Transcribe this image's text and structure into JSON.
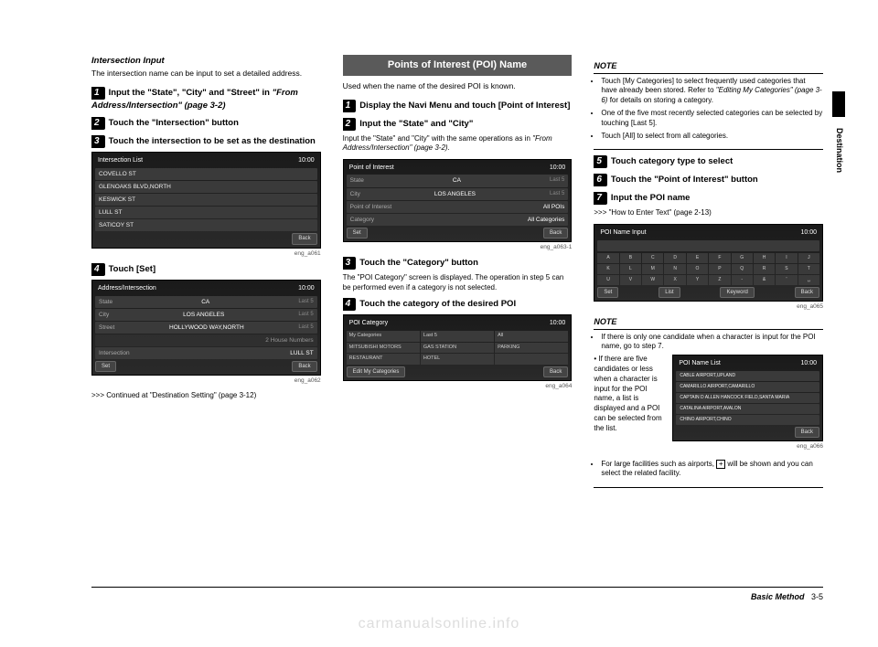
{
  "side_tab": "Destination",
  "footer": {
    "label": "Basic Method",
    "page": "3-5"
  },
  "watermark": "carmanualsonline.info",
  "col1": {
    "h1": "Intersection Input",
    "p1": "The intersection name can be input to set a detailed address.",
    "s1": "Input the \"State\", \"City\" and \"Street\" in ",
    "s1_i": "\"From Address/Intersection\" (page 3-2)",
    "s2": "Touch the \"Intersection\" button",
    "s3": "Touch the intersection to be set as the destination",
    "shot1": {
      "title": "Intersection List",
      "time": "10:00",
      "rows": [
        "COVELLO ST",
        "GLENOAKS BLVD,NORTH",
        "KESWICK ST",
        "LULL ST",
        "SATICOY ST"
      ],
      "back": "Back",
      "cap": "eng_a061"
    },
    "s4": "Touch [Set]",
    "shot2": {
      "title": "Address/Intersection",
      "time": "10:00",
      "rows": [
        {
          "label": "State",
          "val": "CA",
          "r": "Last 5"
        },
        {
          "label": "City",
          "val": "LOS ANGELES",
          "r": "Last 5"
        },
        {
          "label": "Street",
          "val": "HOLLYWOOD WAY,NORTH",
          "r": "Last 5"
        },
        {
          "label": "",
          "val": "2 House Numbers",
          "r": ""
        },
        {
          "label": "Intersection",
          "val": "LULL ST",
          "r": ""
        }
      ],
      "set": "Set",
      "back": "Back",
      "cap": "eng_a062"
    },
    "cont": ">>> Continued at \"Destination Setting\" (page 3-12)"
  },
  "col2": {
    "title": "Points of Interest (POI) Name",
    "p1": "Used when the name of the desired POI is known.",
    "s1": "Display the Navi Menu and touch [Point of Interest]",
    "s2": "Input the \"State\" and \"City\"",
    "s2_sub_a": "Input the \"State\" and \"City\" with the same operations as in ",
    "s2_sub_i": "\"From Address/Intersection\" (page 3-2).",
    "shot1": {
      "title": "Point of Interest",
      "time": "10:00",
      "rows": [
        {
          "label": "State",
          "val": "CA",
          "r": "Last 5"
        },
        {
          "label": "City",
          "val": "LOS ANGELES",
          "r": "Last 5"
        },
        {
          "label": "Point of Interest",
          "val": "All POIs",
          "r": ""
        },
        {
          "label": "Category",
          "val": "All Categories",
          "r": ""
        }
      ],
      "set": "Set",
      "back": "Back",
      "cap": "eng_a063-1"
    },
    "s3": "Touch the \"Category\" button",
    "s3_sub": "The \"POI Category\" screen is displayed.\nThe operation in step 5 can be performed even if a category is not selected.",
    "s4": "Touch the category of the desired POI",
    "shot2": {
      "title": "POI Category",
      "time": "10:00",
      "tabs": [
        "My Categories",
        "Last 5",
        "All"
      ],
      "cells": [
        "MITSUBISHI MOTORS",
        "GAS STATION",
        "PARKING",
        "RESTAURANT",
        "HOTEL",
        ""
      ],
      "edit": "Edit My Categories",
      "back": "Back",
      "cap": "eng_a064"
    }
  },
  "col3": {
    "note1_h": "NOTE",
    "note1": [
      "Touch [My Categories] to select frequently used categories that have already been stored. Refer to ",
      "\"Editing My Categories\" (page 3-6)",
      " for details on storing a category.",
      "One of the five most recently selected categories can be selected by touching [Last 5].",
      "Touch [All] to select from all categories."
    ],
    "s5": "Touch category type to select",
    "s6": "Touch the \"Point of Interest\" button",
    "s7": "Input the POI name",
    "s7_sub": ">>> \"How to Enter Text\" (page 2-13)",
    "shot1": {
      "title": "POI Name Input",
      "time": "10:00",
      "input": "",
      "footer": [
        "Set",
        "List",
        "Keyword",
        "Back"
      ],
      "cap": "eng_a065"
    },
    "note2_h": "NOTE",
    "note2_li1": "If there is only one candidate when a character is input for the POI name, go to step 7.",
    "note2_li2": "If there are five candidates or less when a character is input for the POI name, a list is displayed and a POI can be selected from the list.",
    "shot2": {
      "title": "POI Name List",
      "time": "10:00",
      "rows": [
        "CABLE AIRPORT,UPLAND",
        "CAMARILLO AIRPORT,CAMARILLO",
        "CAPTAIN D ALLEN HANCOCK FIELD,SANTA MARIA",
        "CATALINA AIRPORT,AVALON",
        "CHINO AIRPORT,CHINO"
      ],
      "back": "Back",
      "cap": "eng_a066"
    },
    "note2_li3a": "For large facilities such as airports, ",
    "note2_li3b": " will be shown and you can select the related facility."
  }
}
